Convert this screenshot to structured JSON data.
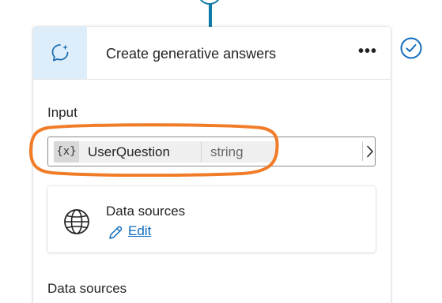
{
  "card": {
    "title": "Create generative answers",
    "more_label": "•••"
  },
  "input_section": {
    "label": "Input",
    "variable": {
      "icon_text": "{x}",
      "name": "UserQuestion",
      "type": "string"
    }
  },
  "datasource_card": {
    "title": "Data sources",
    "edit_label": "Edit"
  },
  "bottom_section": {
    "label": "Data sources"
  },
  "icons": {
    "header": "generative-answers-icon",
    "more": "more-horizontal-icon",
    "chevron": "chevron-right-icon",
    "globe": "globe-icon",
    "edit": "pencil-icon",
    "status": "check-circle-icon"
  },
  "colors": {
    "accent": "#0f7ba8",
    "header_icon_bg": "#ddeefa",
    "link": "#0f6cbd",
    "highlight": "#f07c28"
  }
}
